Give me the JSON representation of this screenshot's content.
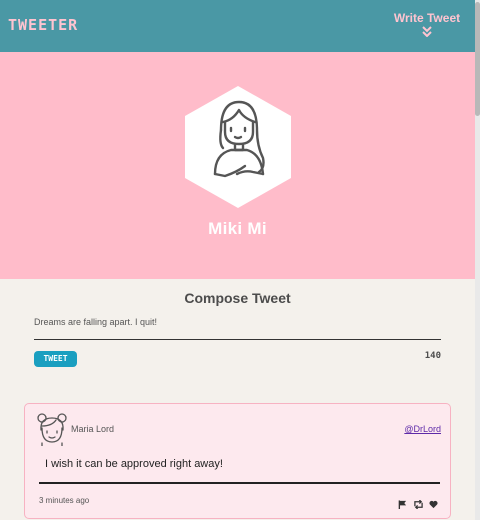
{
  "nav": {
    "brand": "TWEETER",
    "write_label": "Write Tweet",
    "write_icon": "double-chevron-down-icon"
  },
  "profile": {
    "name": "Miki Mi",
    "avatar_icon": "girl-avatar-icon"
  },
  "compose": {
    "title": "Compose Tweet",
    "text": "Dreams are falling apart. I quit!",
    "button_label": "TWEET",
    "counter": "140"
  },
  "tweets": [
    {
      "author": "Maria Lord",
      "handle": "@DrLord",
      "text": "I wish it can be approved right away!",
      "time": "3 minutes ago",
      "avatar_icon": "girl-buns-avatar-icon",
      "action_icons": [
        "flag-icon",
        "retweet-icon",
        "heart-icon"
      ]
    }
  ],
  "colors": {
    "nav": "#4a98a5",
    "accent_pink": "#ffc4d0",
    "hero": "#ffbcca",
    "page": "#f4f1ec",
    "tweet_button": "#1a9fc0",
    "card": "#fde9ee",
    "card_border": "#f7b2c2"
  }
}
